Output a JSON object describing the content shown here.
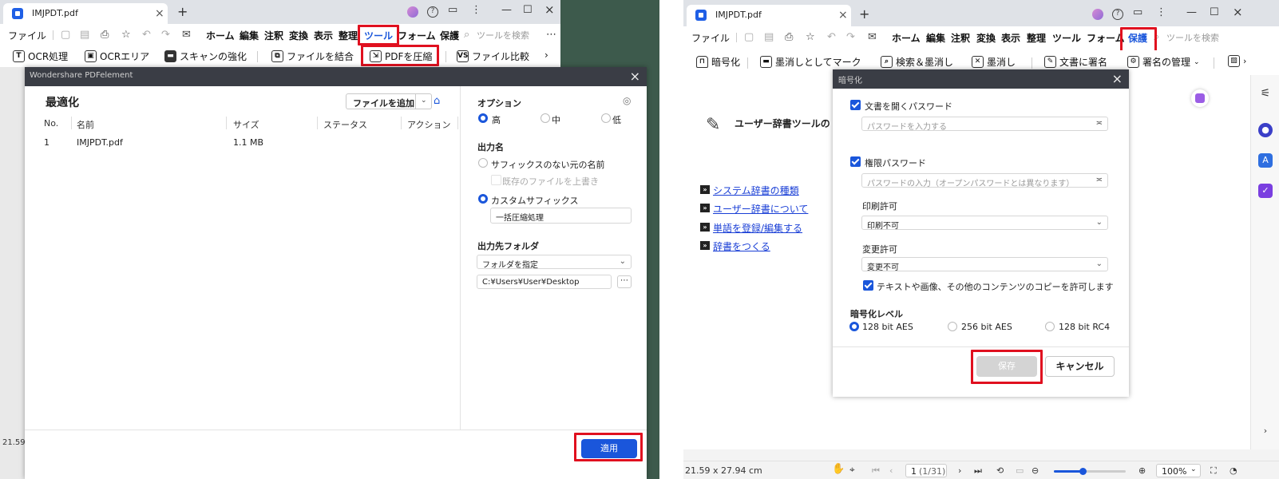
{
  "left": {
    "tab_title": "IMJPDT.pdf",
    "menu": {
      "file": "ファイル",
      "home": "ホーム",
      "edit": "編集",
      "comment": "注釈",
      "convert": "変換",
      "view": "表示",
      "organize": "整理",
      "tools": "ツール",
      "form": "フォーム",
      "protect": "保護",
      "search_placeholder": "ツールを検索"
    },
    "toolbar": {
      "ocr": "OCR処理",
      "ocr_area": "OCRエリア",
      "scan_enhance": "スキャンの強化",
      "combine": "ファイルを結合",
      "compress": "PDFを圧縮",
      "compare": "ファイル比較"
    },
    "side_value": "21.59",
    "dialog": {
      "title": "Wondershare PDFelement",
      "heading": "最適化",
      "add_file_button": "ファイルを追加",
      "columns": [
        "No.",
        "名前",
        "サイズ",
        "ステータス",
        "アクション"
      ],
      "rows": [
        {
          "no": "1",
          "name": "IMJPDT.pdf",
          "size": "1.1 MB"
        }
      ],
      "options_label": "オプション",
      "quality_high": "高",
      "quality_mid": "中",
      "quality_low": "低",
      "output_name_label": "出力名",
      "original_name_option": "サフィックスのない元の名前",
      "overwrite_option": "既存のファイルを上書き",
      "custom_suffix_option": "カスタムサフィックス",
      "custom_suffix_value": "一括圧縮処理",
      "dest_folder_label": "出力先フォルダ",
      "folder_select": "フォルダを指定",
      "folder_path": "C:¥Users¥User¥Desktop",
      "apply_button": "適用"
    }
  },
  "right": {
    "tab_title": "IMJPDT.pdf",
    "menu": {
      "file": "ファイル",
      "home": "ホーム",
      "edit": "編集",
      "comment": "注釈",
      "convert": "変換",
      "view": "表示",
      "organize": "整理",
      "tools": "ツール",
      "form": "フォーム",
      "protect": "保護",
      "search_placeholder": "ツールを検索"
    },
    "toolbar": {
      "encrypt": "暗号化",
      "mark_redact": "墨消しとしてマーク",
      "search_redact": "検索＆墨消し",
      "redact": "墨消し",
      "sign": "文書に署名",
      "manage_sign": "署名の管理"
    },
    "document": {
      "heading": "ユーザー辞書ツールの",
      "links": [
        "システム辞書の種類",
        "ユーザー辞書について",
        "単語を登録/編集する",
        "辞書をつくる"
      ]
    },
    "encrypt_dialog": {
      "title": "暗号化",
      "open_password_label": "文書を開くパスワード",
      "open_password_placeholder": "パスワードを入力する",
      "perm_password_label": "権限パスワード",
      "perm_password_placeholder": "パスワードの入力（オープンパスワードとは異なります）",
      "print_label": "印刷許可",
      "print_value": "印刷不可",
      "change_label": "変更許可",
      "change_value": "変更不可",
      "copy_label": "テキストや画像、その他のコンテンツのコピーを許可します",
      "level_label": "暗号化レベル",
      "level_128aes": "128 bit AES",
      "level_256aes": "256 bit AES",
      "level_128rc4": "128 bit RC4",
      "save_button": "保存",
      "cancel_button": "キャンセル"
    },
    "status": {
      "page_size": "21.59 x 27.94 cm",
      "page_current": "1",
      "page_total": "(1/31)",
      "zoom": "100%"
    }
  },
  "colors": {
    "accent": "#1a56db",
    "highlight_box": "#e0101f",
    "dialog_header": "#3a3d45",
    "desktop": "#3d5a4c"
  }
}
